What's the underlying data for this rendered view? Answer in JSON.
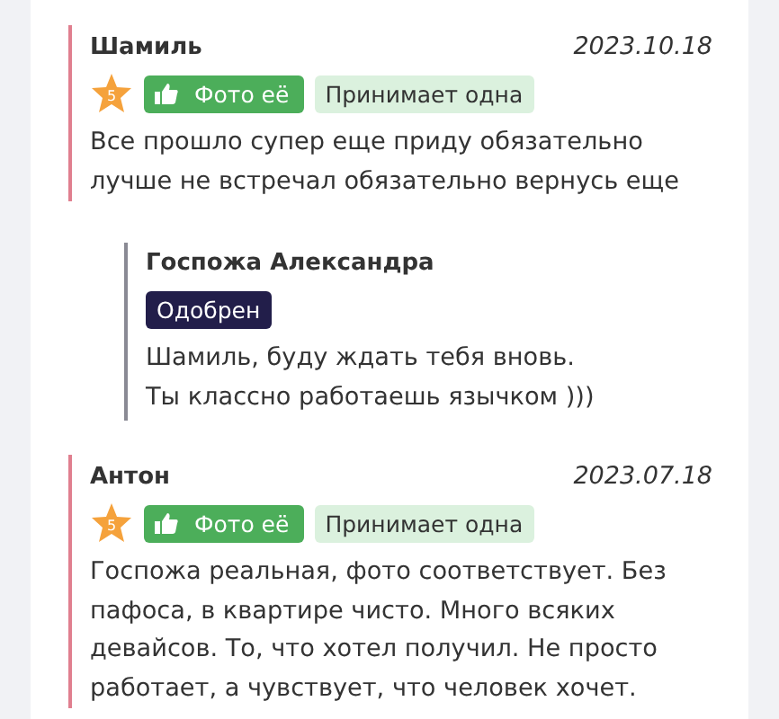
{
  "reviews": [
    {
      "author": "Шамиль",
      "date": "2023.10.18",
      "rating": "5",
      "tags": [
        {
          "kind": "photo",
          "label": "Фото её"
        },
        {
          "kind": "plain",
          "label": "Принимает одна"
        }
      ],
      "text": "Все прошло супер еще приду обязательно лучше не встречал обязательно вернусь еще",
      "reply": {
        "author": "Госпожа Александра",
        "status": "Одобрен",
        "text": "Шамиль, буду ждать тебя вновь. Ты классно работаешь язычком )))"
      }
    },
    {
      "author": "Антон",
      "date": "2023.07.18",
      "rating": "5",
      "tags": [
        {
          "kind": "photo",
          "label": "Фото её"
        },
        {
          "kind": "plain",
          "label": "Принимает одна"
        }
      ],
      "text": "Госпожа реальная, фото соответствует. Без пафоса, в квартире чисто. Много всяких девайсов. То, что хотел получил. Не просто работает, а чувствует, что человек хочет."
    }
  ]
}
